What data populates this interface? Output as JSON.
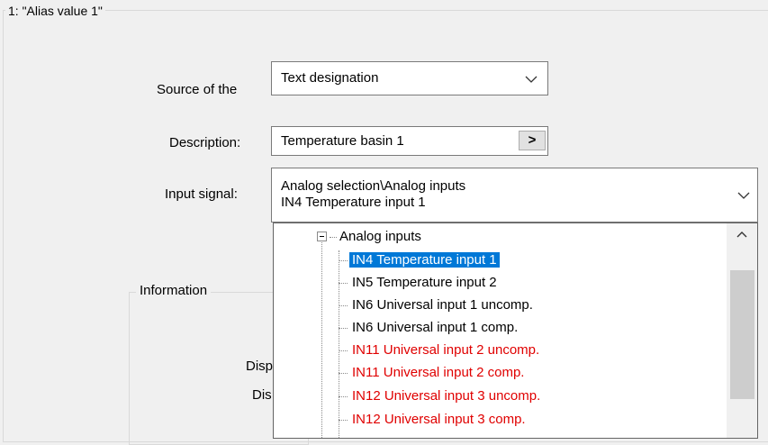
{
  "group": {
    "title": "1: \"Alias value 1\""
  },
  "source": {
    "label": "Source of the",
    "value": "Text designation"
  },
  "description": {
    "label": "Description:",
    "value": "Temperature basin 1",
    "button_label": ">"
  },
  "input_signal": {
    "label": "Input signal:",
    "value_line1": "Analog selection\\Analog inputs",
    "value_line2": "IN4 Temperature input 1"
  },
  "information": {
    "title": "Information",
    "label1": "Disp",
    "label2": "Dis"
  },
  "tree": {
    "parent": "Analog inputs",
    "items": [
      {
        "label": "IN4 Temperature input 1",
        "state": "selected"
      },
      {
        "label": "IN5 Temperature input 2",
        "state": "normal"
      },
      {
        "label": "IN6 Universal input 1 uncomp.",
        "state": "normal"
      },
      {
        "label": "IN6 Universal input 1 comp.",
        "state": "normal"
      },
      {
        "label": "IN11 Universal input 2 uncomp.",
        "state": "error"
      },
      {
        "label": "IN11 Universal input 2 comp.",
        "state": "error"
      },
      {
        "label": "IN12 Universal input 3 uncomp.",
        "state": "error"
      },
      {
        "label": "IN12 Universal input 3 comp.",
        "state": "error"
      }
    ]
  },
  "colors": {
    "selection": "#0078d7",
    "error_text": "#e00000",
    "background": "#f0f0f0"
  }
}
